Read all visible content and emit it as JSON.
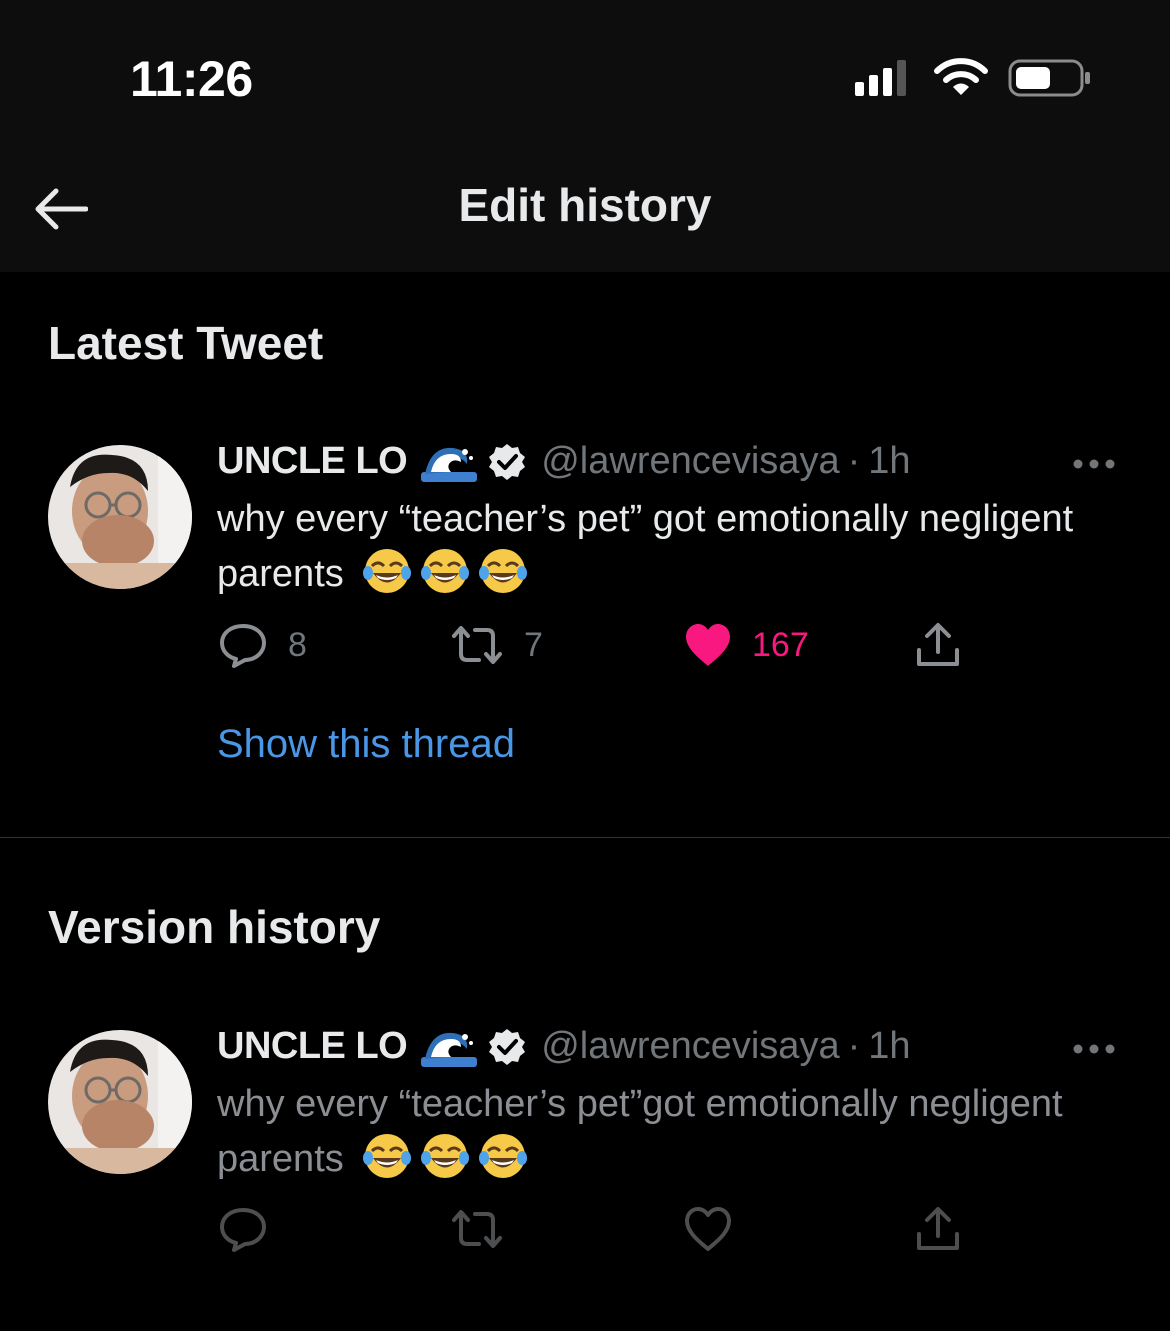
{
  "status_bar": {
    "time": "11:26"
  },
  "header": {
    "title": "Edit history"
  },
  "latest": {
    "section_title": "Latest Tweet",
    "tweet": {
      "display_name": "UNCLE LO",
      "handle": "@lawrencevisaya",
      "separator": "·",
      "time": "1h",
      "text": "why every “teacher’s pet” got emotionally negligent parents",
      "reply_count": "8",
      "retweet_count": "7",
      "like_count": "167",
      "liked": true
    },
    "show_thread_label": "Show this thread"
  },
  "history": {
    "section_title": "Version history",
    "tweet": {
      "display_name": "UNCLE LO",
      "handle": "@lawrencevisaya",
      "separator": "·",
      "time": "1h",
      "text": "why every “teacher’s pet”got emotionally negligent parents"
    }
  },
  "icons": {
    "back": "arrow-left-icon",
    "emoji_name": "wave-emoji",
    "emoji_text": "laughing-tears-emoji",
    "verified": "verified-badge-icon",
    "more": "more-horizontal-icon",
    "reply": "reply-icon",
    "retweet": "retweet-icon",
    "like": "heart-icon",
    "share": "share-icon"
  },
  "colors": {
    "background": "#000000",
    "header_bg": "#0d0d0d",
    "text": "#e7e9ea",
    "muted": "#71767b",
    "link": "#4a97e8",
    "like": "#f91880",
    "divider": "#2f3336"
  }
}
